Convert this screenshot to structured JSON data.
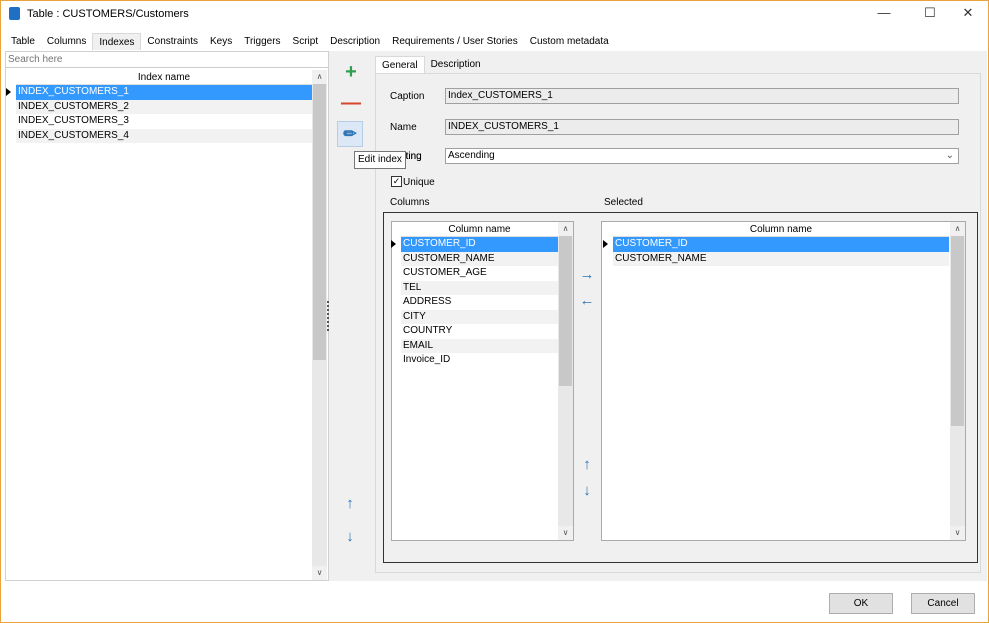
{
  "window": {
    "title": "Table : CUSTOMERS/Customers",
    "border_color": "#e8a33c"
  },
  "tabs": [
    "Table",
    "Columns",
    "Indexes",
    "Constraints",
    "Keys",
    "Triggers",
    "Script",
    "Description",
    "Requirements / User Stories",
    "Custom metadata"
  ],
  "active_tab": "Indexes",
  "left": {
    "search_placeholder": "Search here",
    "header": "Index name",
    "rows": [
      "INDEX_CUSTOMERS_1",
      "INDEX_CUSTOMERS_2",
      "INDEX_CUSTOMERS_3",
      "INDEX_CUSTOMERS_4"
    ],
    "selected": 0
  },
  "toolbar": {
    "add_icon": "plus-icon",
    "remove_icon": "minus-icon",
    "edit_icon": "pencil-icon",
    "tooltip": "Edit index",
    "up_icon": "arrow-up-icon",
    "down_icon": "arrow-down-icon"
  },
  "detail_tabs": [
    "General",
    "Description"
  ],
  "form": {
    "caption_label": "Caption",
    "caption_value": "Index_CUSTOMERS_1",
    "name_label": "Name",
    "name_value": "INDEX_CUSTOMERS_1",
    "sorting_label": "Sorting",
    "sorting_visible": "ting",
    "sorting_value": "Ascending",
    "unique_label": "Unique",
    "unique_checked": true
  },
  "columns": {
    "label": "Columns",
    "header": "Column name",
    "rows": [
      "CUSTOMER_ID",
      "CUSTOMER_NAME",
      "CUSTOMER_AGE",
      "TEL",
      "ADDRESS",
      "CITY",
      "COUNTRY",
      "EMAIL",
      "Invoice_ID"
    ],
    "selected": 0
  },
  "selected": {
    "label": "Selected",
    "header": "Column name",
    "rows": [
      "CUSTOMER_ID",
      "CUSTOMER_NAME"
    ],
    "selected": 0
  },
  "buttons": {
    "ok": "OK",
    "cancel": "Cancel"
  },
  "colors": {
    "selection": "#3399ff",
    "add": "#2e9e4f",
    "remove": "#d9452b",
    "arrow": "#2e74b5"
  }
}
